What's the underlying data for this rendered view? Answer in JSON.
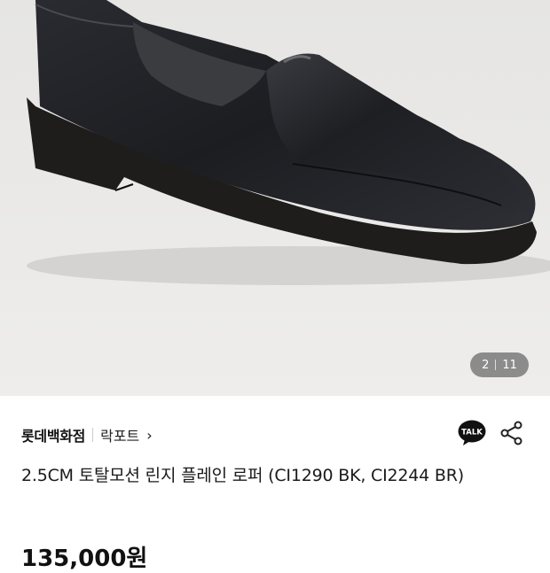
{
  "gallery": {
    "image_alt": "black leather loafer",
    "current": "2",
    "total": "11"
  },
  "seller": {
    "store_name": "롯데백화점",
    "brand_name": "락포트",
    "brand_chevron": "›"
  },
  "actions": {
    "talk_label": "TALK"
  },
  "product": {
    "title": "2.5CM 토탈모션 린지 플레인 로퍼 (CI1290 BK, CI2244 BR)",
    "price": "135,000원"
  },
  "colors": {
    "background": "#e9e8e6",
    "shoe": "#1b1c20",
    "accent_text": "#111111"
  }
}
